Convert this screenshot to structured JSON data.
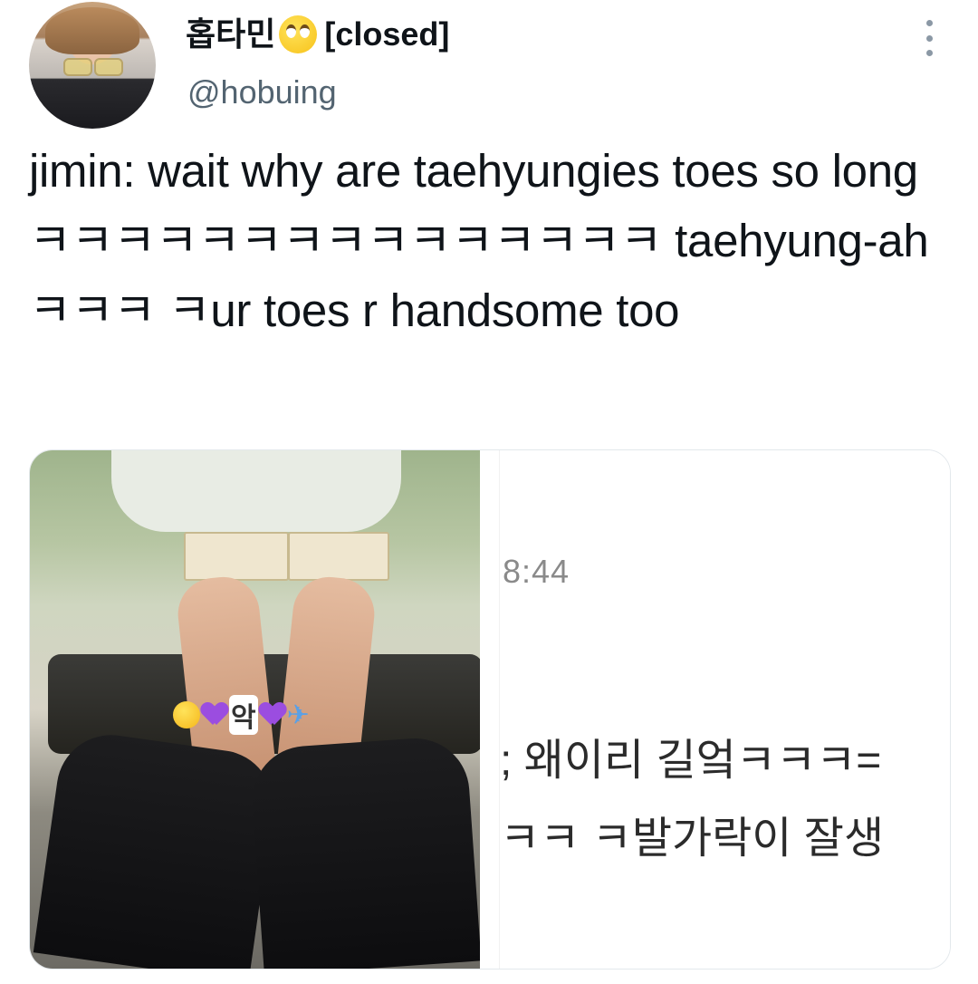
{
  "tweet": {
    "display_name": "홉타민",
    "status_tag": "[closed]",
    "handle": "@hobuing",
    "text": "jimin: wait why are taehyungies toes so longㅋㅋㅋㅋㅋㅋㅋㅋㅋㅋㅋㅋㅋㅋㅋ taehyung-ahㅋㅋㅋ ㅋur toes r handsome too"
  },
  "icons": {
    "name_emoji": "face-with-rolling-eyes-icon",
    "more": "more-options-icon"
  },
  "media": {
    "left_photo": {
      "sticker_text": "악",
      "sticker_icons": [
        "grinning-sweat-icon",
        "purple-heart-icon",
        "purple-heart-icon",
        "airplane-icon"
      ]
    },
    "right_photo": {
      "time": ")8:44",
      "line1": "; 왜이리 길엌ㅋㅋㅋ=",
      "line2": "ㅋㅋ ㅋ발가락이 잘생"
    }
  },
  "colors": {
    "text": "#0f1419",
    "secondary": "#536471",
    "heart": "#9b4de0"
  }
}
